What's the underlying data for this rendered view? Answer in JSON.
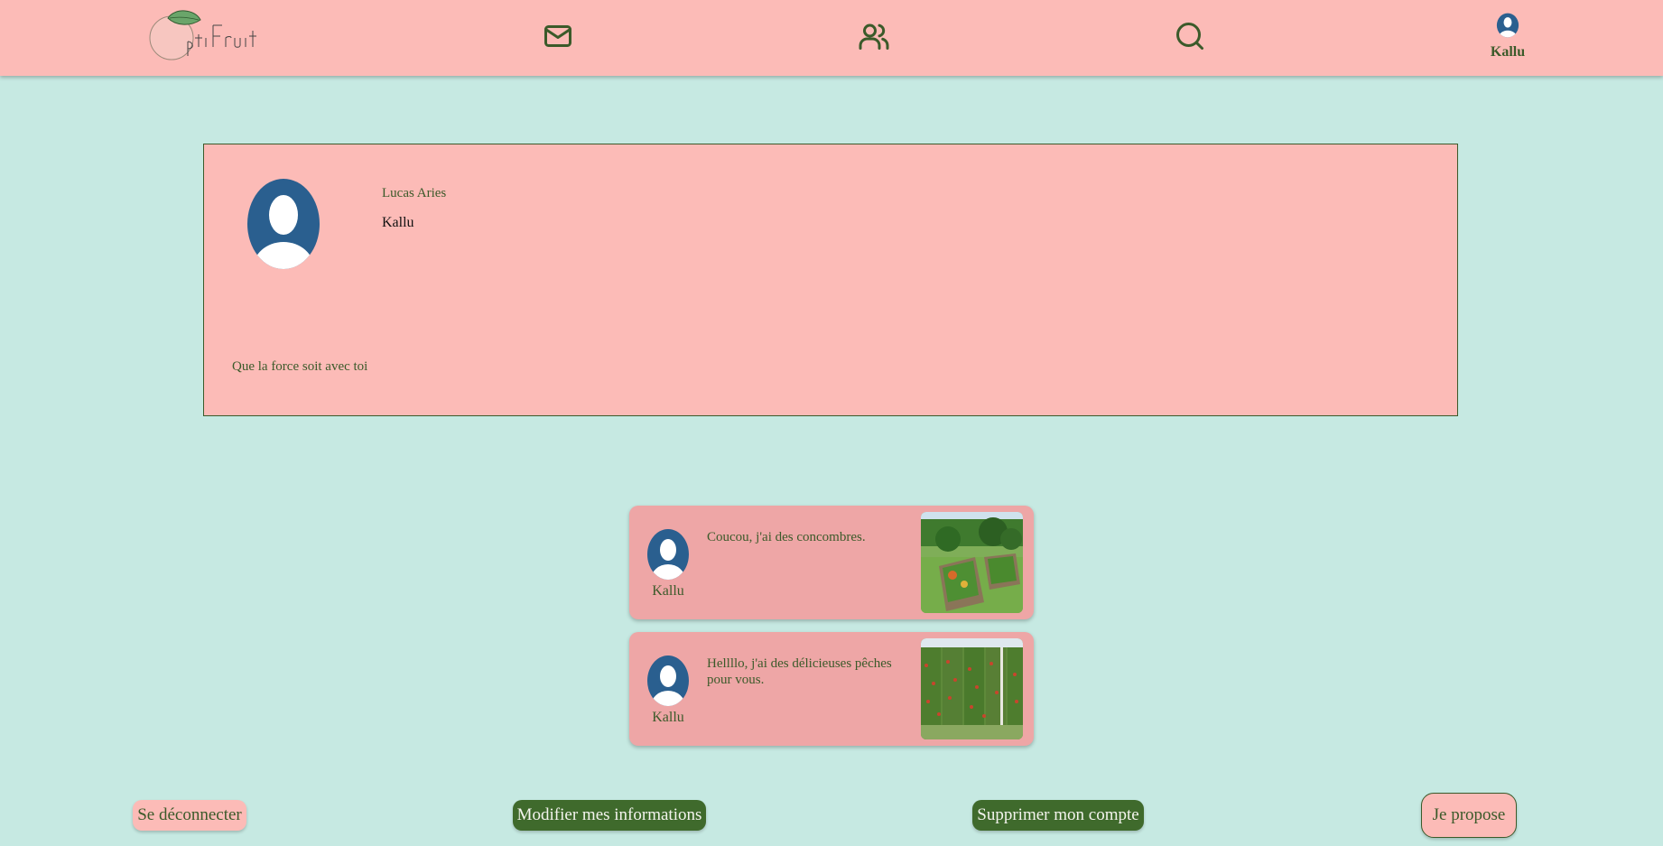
{
  "header": {
    "logo_text": "Opti'Fruit",
    "nav": [
      {
        "icon": "mail-icon"
      },
      {
        "icon": "users-icon"
      },
      {
        "icon": "search-icon"
      }
    ],
    "user": {
      "name": "Kallu",
      "icon": "user-avatar-icon"
    }
  },
  "profile": {
    "full_name": "Lucas Aries",
    "username": "Kallu",
    "bio": "Que la force soit avec toi"
  },
  "posts": [
    {
      "author": "Kallu",
      "text": "Coucou, j'ai des concombres.",
      "image": "garden-beds-photo"
    },
    {
      "author": "Kallu",
      "text": "Hellllo, j'ai des délicieuses pêches pour vous.",
      "image": "orchard-photo"
    }
  ],
  "actions": {
    "logout": "Se déconnecter",
    "edit_info": "Modifier mes informations",
    "delete_account": "Supprimer mon compte",
    "propose": "Je propose"
  },
  "colors": {
    "background": "#c6e9e2",
    "pink": "#fcbbb7",
    "post_pink": "#eea6a6",
    "green": "#3f6a2c",
    "avatar_blue": "#2a5f8f"
  }
}
